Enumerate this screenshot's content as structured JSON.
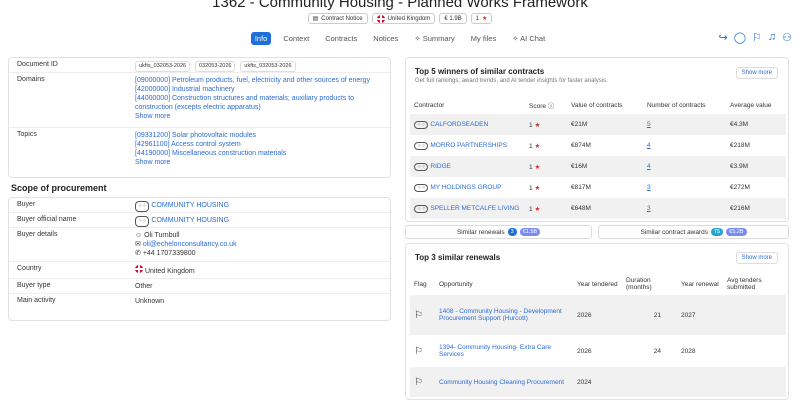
{
  "header": {
    "title": "1362 - Community Housing - Planned Works Framework",
    "notice_type": "Contract Notice",
    "country": "United Kingdom",
    "value": "€ 1.9B",
    "score": "1"
  },
  "tabs": [
    {
      "label": "Info"
    },
    {
      "label": "Context"
    },
    {
      "label": "Contracts"
    },
    {
      "label": "Notices"
    },
    {
      "label": "Summary"
    },
    {
      "label": "My files"
    },
    {
      "label": "AI Chat"
    }
  ],
  "colors": {
    "accent": "#1e6fd9",
    "star": "#d32f2f"
  },
  "details": {
    "document_id_label": "Document ID",
    "document_ids": [
      "ukfts_032053-2026",
      "032053-2026",
      "ukfts_032053-2026"
    ],
    "domains_label": "Domains",
    "domains": [
      "[09000000] Petroleum products, fuel, electricity and other sources of energy",
      "[42000000] Industrial machinery",
      "[44000000] Construction structures and materials; auxiliary products to construction (excepts electric apparatus)"
    ],
    "topics_label": "Topics",
    "topics": [
      "[09331200] Solar photovoltaic modules",
      "[42961100] Access control system",
      "[44190000] Miscellaneous construction materials"
    ],
    "show_more": "Show more"
  },
  "scope": {
    "title": "Scope of procurement",
    "buyer_label": "Buyer",
    "buyer": "COMMUNITY HOUSING",
    "buyer_official_label": "Buyer official name",
    "buyer_official": "COMMUNITY HOUSING",
    "buyer_details_label": "Buyer details",
    "contact_name": "Oli Turnbull",
    "contact_email": "oli@echelonconsultancy.co.uk",
    "contact_phone": "+44 1707339800",
    "country_label": "Country",
    "country": "United Kingdom",
    "buyer_type_label": "Buyer type",
    "buyer_type": "Other",
    "main_activity_label": "Main activity",
    "main_activity": "Unknown"
  },
  "winners": {
    "title": "Top 5 winners of similar contracts",
    "subtitle": "Get full rankings, award trends, and AI tender insights for faster analysis.",
    "show_more": "Show more",
    "columns": [
      "Contractor",
      "Score",
      "Value of contracts",
      "Number of contracts",
      "Average value"
    ],
    "rows": [
      {
        "name": "CALFORDSEADEN",
        "score": "1",
        "value": "€21M",
        "count": "5",
        "avg": "€4.3M"
      },
      {
        "name": "MORRO PARTNERSHIPS",
        "score": "1",
        "value": "€874M",
        "count": "4",
        "avg": "€218M"
      },
      {
        "name": "RIDGE",
        "score": "1",
        "value": "€16M",
        "count": "4",
        "avg": "€3.9M"
      },
      {
        "name": "MY HOLDINGS GROUP",
        "score": "1",
        "value": "€817M",
        "count": "3",
        "avg": "€272M"
      },
      {
        "name": "SPELLER METCALFE LIVING",
        "score": "1",
        "value": "€648M",
        "count": "3",
        "avg": "€216M"
      }
    ]
  },
  "similar": {
    "renewals_label": "Similar renewals",
    "renewals_count": "3",
    "renewals_value": "€1.5B",
    "awards_label": "Similar contract awards",
    "awards_count": "75",
    "awards_value": "€5.2B"
  },
  "renewals": {
    "title": "Top 3 similar renewals",
    "show_more": "Show more",
    "columns": [
      "Flag",
      "Opportunity",
      "Year tendered",
      "Duration (months)",
      "Year renewal",
      "Avg tenders submitted"
    ],
    "rows": [
      {
        "opportunity": "1408 - Community Housing - Development Procurement Support (Hurcott)",
        "year": "2026",
        "duration": "21",
        "renewal": "2027",
        "avg": ""
      },
      {
        "opportunity": "1394- Community Housing- Extra Care Services",
        "year": "2026",
        "duration": "24",
        "renewal": "2028",
        "avg": ""
      },
      {
        "opportunity": "Community Housing Cleaning Procurement",
        "year": "2024",
        "duration": "",
        "renewal": "",
        "avg": ""
      }
    ]
  }
}
